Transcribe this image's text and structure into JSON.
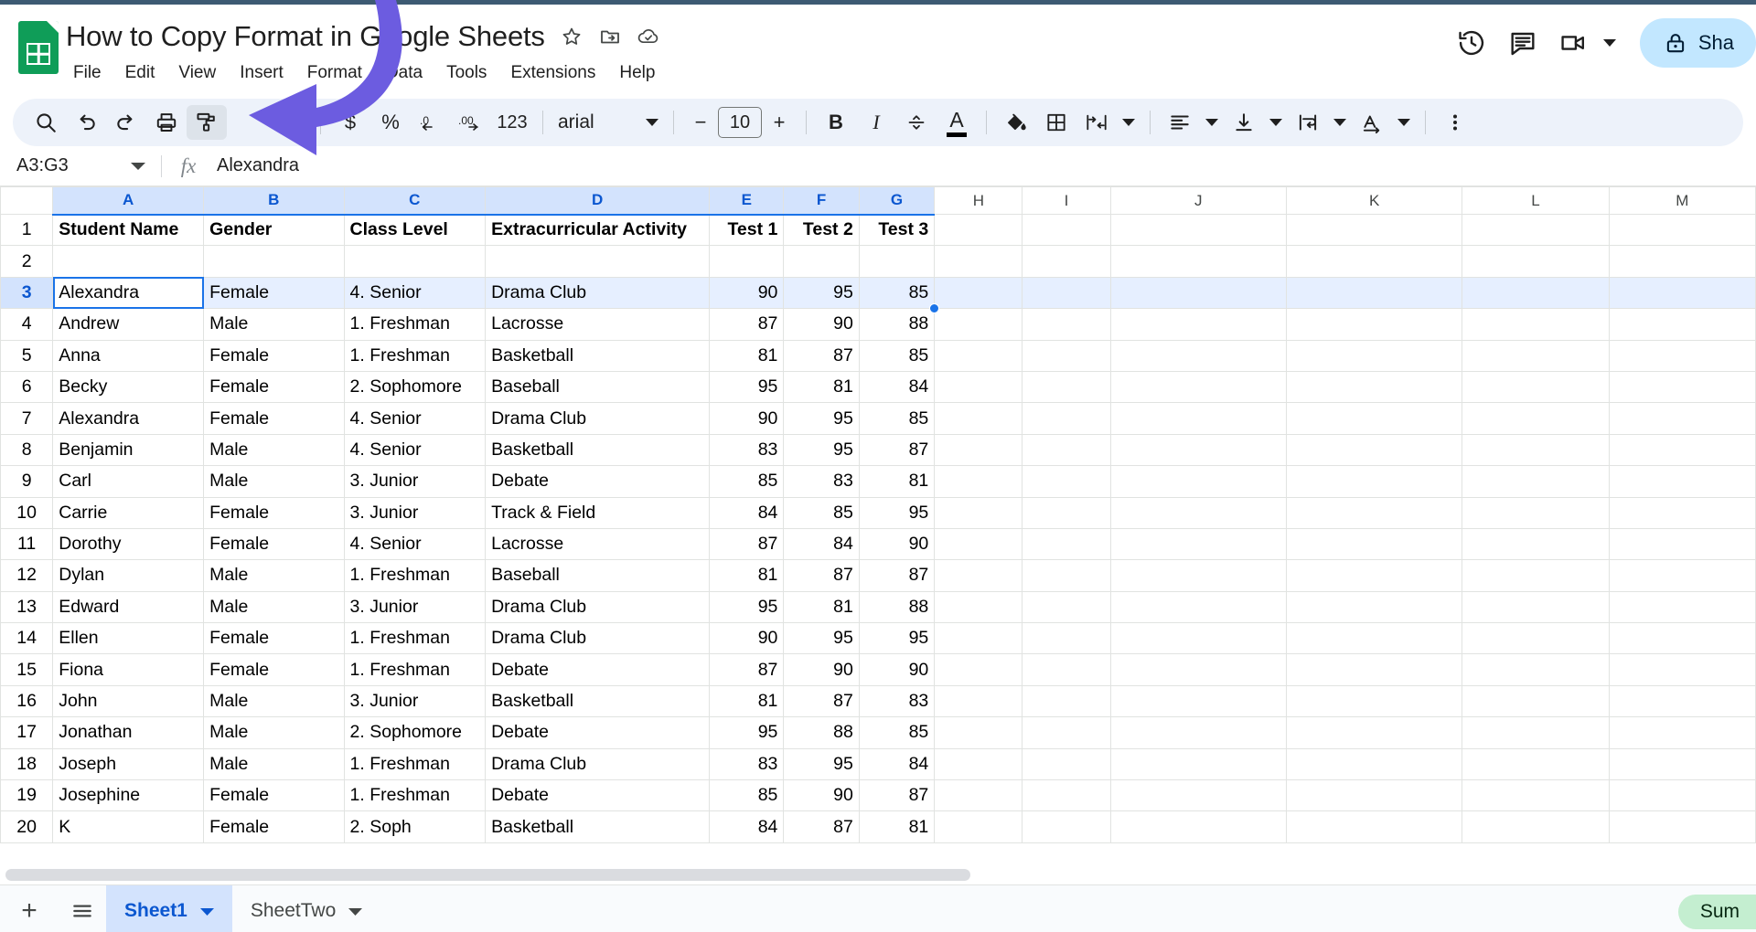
{
  "header": {
    "doc_title": "How to Copy Format in Google Sheets",
    "title_icons": [
      "star-icon",
      "move-to-folder-icon",
      "cloud-saved-icon"
    ],
    "menus": [
      "File",
      "Edit",
      "View",
      "Insert",
      "Format",
      "Data",
      "Tools",
      "Extensions",
      "Help"
    ],
    "right_icons": [
      "version-history-icon",
      "comment-icon",
      "meet-camera-icon"
    ],
    "share_label": "Sha"
  },
  "toolbar": {
    "icons": [
      "search-icon",
      "undo-icon",
      "redo-icon",
      "print-icon",
      "paint-format-icon"
    ],
    "zoom_label": "",
    "currency_label": "$",
    "percent_label": "%",
    "decrease_decimal_label": ".0",
    "increase_decimal_label": ".00",
    "more_formats_label": "123",
    "font_name": "arial",
    "font_size": "10",
    "minus_label": "−",
    "plus_label": "+",
    "bold_label": "B",
    "italic_label": "I",
    "strikethrough_label": "strikethrough-icon",
    "text_color_label": "A",
    "fill_color_icon": "fill-color-icon",
    "borders_icon": "borders-icon",
    "merge_cells_icon": "merge-cells-icon",
    "horizontal_align_icon": "horizontal-align-icon",
    "vertical_align_icon": "vertical-align-icon",
    "text_wrap_icon": "text-wrapping-icon",
    "text_rotation_icon": "text-rotation-icon",
    "more_icon": "more-options-icon"
  },
  "formula_bar": {
    "name_box": "A3:G3",
    "fx_label": "fx",
    "value": "Alexandra"
  },
  "grid": {
    "columns": [
      "A",
      "B",
      "C",
      "D",
      "E",
      "F",
      "G",
      "H",
      "I",
      "J",
      "K",
      "L",
      "M"
    ],
    "selected_columns": [
      "A",
      "B",
      "C",
      "D",
      "E",
      "F",
      "G"
    ],
    "selected_row": 3,
    "active_cell": "A3",
    "rows": [
      {
        "n": 1,
        "cells": [
          "Student Name",
          "Gender",
          "Class Level",
          "Extracurricular Activity",
          "Test 1",
          "Test 2",
          "Test 3"
        ],
        "bold": true
      },
      {
        "n": 2,
        "cells": [
          "",
          "",
          "",
          "",
          "",
          "",
          ""
        ],
        "bold": false
      },
      {
        "n": 3,
        "cells": [
          "Alexandra",
          "Female",
          "4. Senior",
          "Drama Club",
          "90",
          "95",
          "85"
        ],
        "bold": false
      },
      {
        "n": 4,
        "cells": [
          "Andrew",
          "Male",
          "1. Freshman",
          "Lacrosse",
          "87",
          "90",
          "88"
        ],
        "bold": false
      },
      {
        "n": 5,
        "cells": [
          "Anna",
          "Female",
          "1. Freshman",
          "Basketball",
          "81",
          "87",
          "85"
        ],
        "bold": false
      },
      {
        "n": 6,
        "cells": [
          "Becky",
          "Female",
          "2. Sophomore",
          "Baseball",
          "95",
          "81",
          "84"
        ],
        "bold": false
      },
      {
        "n": 7,
        "cells": [
          "Alexandra",
          "Female",
          "4. Senior",
          "Drama Club",
          "90",
          "95",
          "85"
        ],
        "bold": false
      },
      {
        "n": 8,
        "cells": [
          "Benjamin",
          "Male",
          "4. Senior",
          "Basketball",
          "83",
          "95",
          "87"
        ],
        "bold": false
      },
      {
        "n": 9,
        "cells": [
          "Carl",
          "Male",
          "3. Junior",
          "Debate",
          "85",
          "83",
          "81"
        ],
        "bold": false
      },
      {
        "n": 10,
        "cells": [
          "Carrie",
          "Female",
          "3. Junior",
          "Track & Field",
          "84",
          "85",
          "95"
        ],
        "bold": false
      },
      {
        "n": 11,
        "cells": [
          "Dorothy",
          "Female",
          "4. Senior",
          "Lacrosse",
          "87",
          "84",
          "90"
        ],
        "bold": false
      },
      {
        "n": 12,
        "cells": [
          "Dylan",
          "Male",
          "1. Freshman",
          "Baseball",
          "81",
          "87",
          "87"
        ],
        "bold": false
      },
      {
        "n": 13,
        "cells": [
          "Edward",
          "Male",
          "3. Junior",
          "Drama Club",
          "95",
          "81",
          "88"
        ],
        "bold": false
      },
      {
        "n": 14,
        "cells": [
          "Ellen",
          "Female",
          "1. Freshman",
          "Drama Club",
          "90",
          "95",
          "95"
        ],
        "bold": false
      },
      {
        "n": 15,
        "cells": [
          "Fiona",
          "Female",
          "1. Freshman",
          "Debate",
          "87",
          "90",
          "90"
        ],
        "bold": false
      },
      {
        "n": 16,
        "cells": [
          "John",
          "Male",
          "3. Junior",
          "Basketball",
          "81",
          "87",
          "83"
        ],
        "bold": false
      },
      {
        "n": 17,
        "cells": [
          "Jonathan",
          "Male",
          "2. Sophomore",
          "Debate",
          "95",
          "88",
          "85"
        ],
        "bold": false
      },
      {
        "n": 18,
        "cells": [
          "Joseph",
          "Male",
          "1. Freshman",
          "Drama Club",
          "83",
          "95",
          "84"
        ],
        "bold": false
      },
      {
        "n": 19,
        "cells": [
          "Josephine",
          "Female",
          "1. Freshman",
          "Debate",
          "85",
          "90",
          "87"
        ],
        "bold": false
      },
      {
        "n": 20,
        "cells": [
          "K",
          "Female",
          "2. Soph",
          "Basketball",
          "84",
          "87",
          "81"
        ],
        "bold": false
      }
    ]
  },
  "bottom": {
    "add_sheet_label": "+",
    "all_sheets_icon": "all-sheets-icon",
    "tabs": [
      {
        "label": "Sheet1",
        "active": true
      },
      {
        "label": "SheetTwo",
        "active": false
      }
    ],
    "sum_label": "Sum"
  },
  "colors": {
    "accent_blue": "#1a73e8",
    "selection_fill": "#e6efff",
    "header_selected": "#d3e3fd",
    "toolbar_bg": "#edf2fa",
    "sheets_green": "#0f9d58",
    "share_bg": "#c2e7ff",
    "sum_bg": "#c4eed0",
    "annotation_purple": "#6c5ce0",
    "top_strip": "#3d5a73"
  }
}
